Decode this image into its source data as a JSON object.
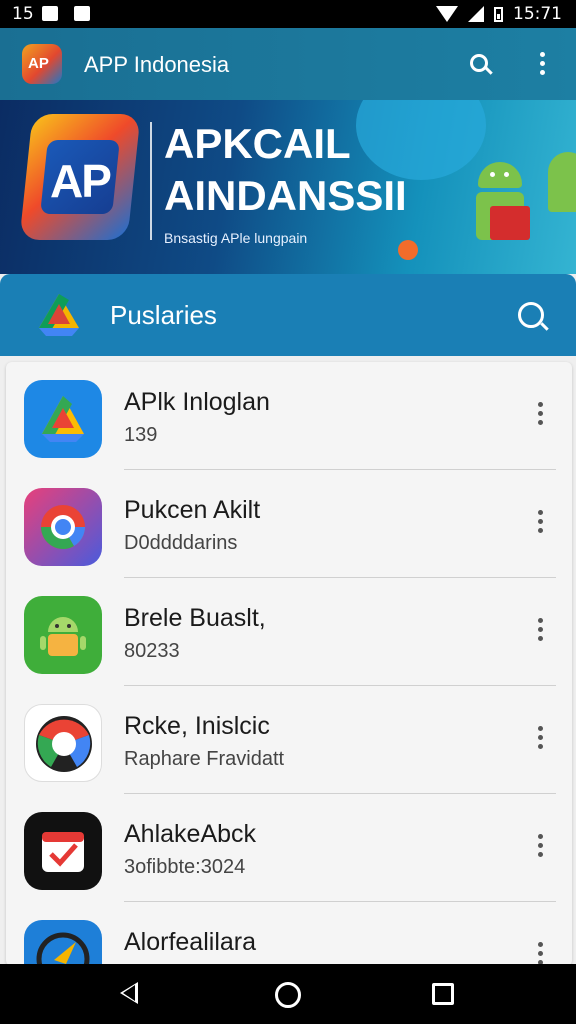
{
  "status_bar": {
    "time_left": "15",
    "time_right": "15:71"
  },
  "app_bar": {
    "title": "APP Indonesia",
    "search_icon": "search-icon",
    "menu_icon": "more-vert-icon"
  },
  "banner": {
    "logo_text": "AP",
    "line1": "APKCAIL",
    "line2": "AINDANSSII",
    "tagline": "Bnsastig APle lungpain"
  },
  "category_header": {
    "title": "Puslaries",
    "icon": "drive-icon",
    "search_icon": "search-icon"
  },
  "apps": [
    {
      "name": "APlk Inloglan",
      "sub": "139",
      "icon": "drive-app-icon"
    },
    {
      "name": "Pukcen Akilt",
      "sub": "D0ddddarins",
      "icon": "chrome-app-icon"
    },
    {
      "name": "Brele Buaslt,",
      "sub": "80233",
      "icon": "android-app-icon"
    },
    {
      "name": "Rcke, Inislcic",
      "sub": "Raphare Fravidatt",
      "icon": "google-app-icon"
    },
    {
      "name": "AhlakeAbck",
      "sub": "3ofibbte:3024",
      "icon": "calendar-check-app-icon"
    },
    {
      "name": "Alorfealilara",
      "sub": "",
      "icon": "compass-app-icon"
    }
  ],
  "colors": {
    "app_bar": "#1a6f93",
    "category_header": "#1a7fb5",
    "list_bg": "#f5f5f5"
  }
}
